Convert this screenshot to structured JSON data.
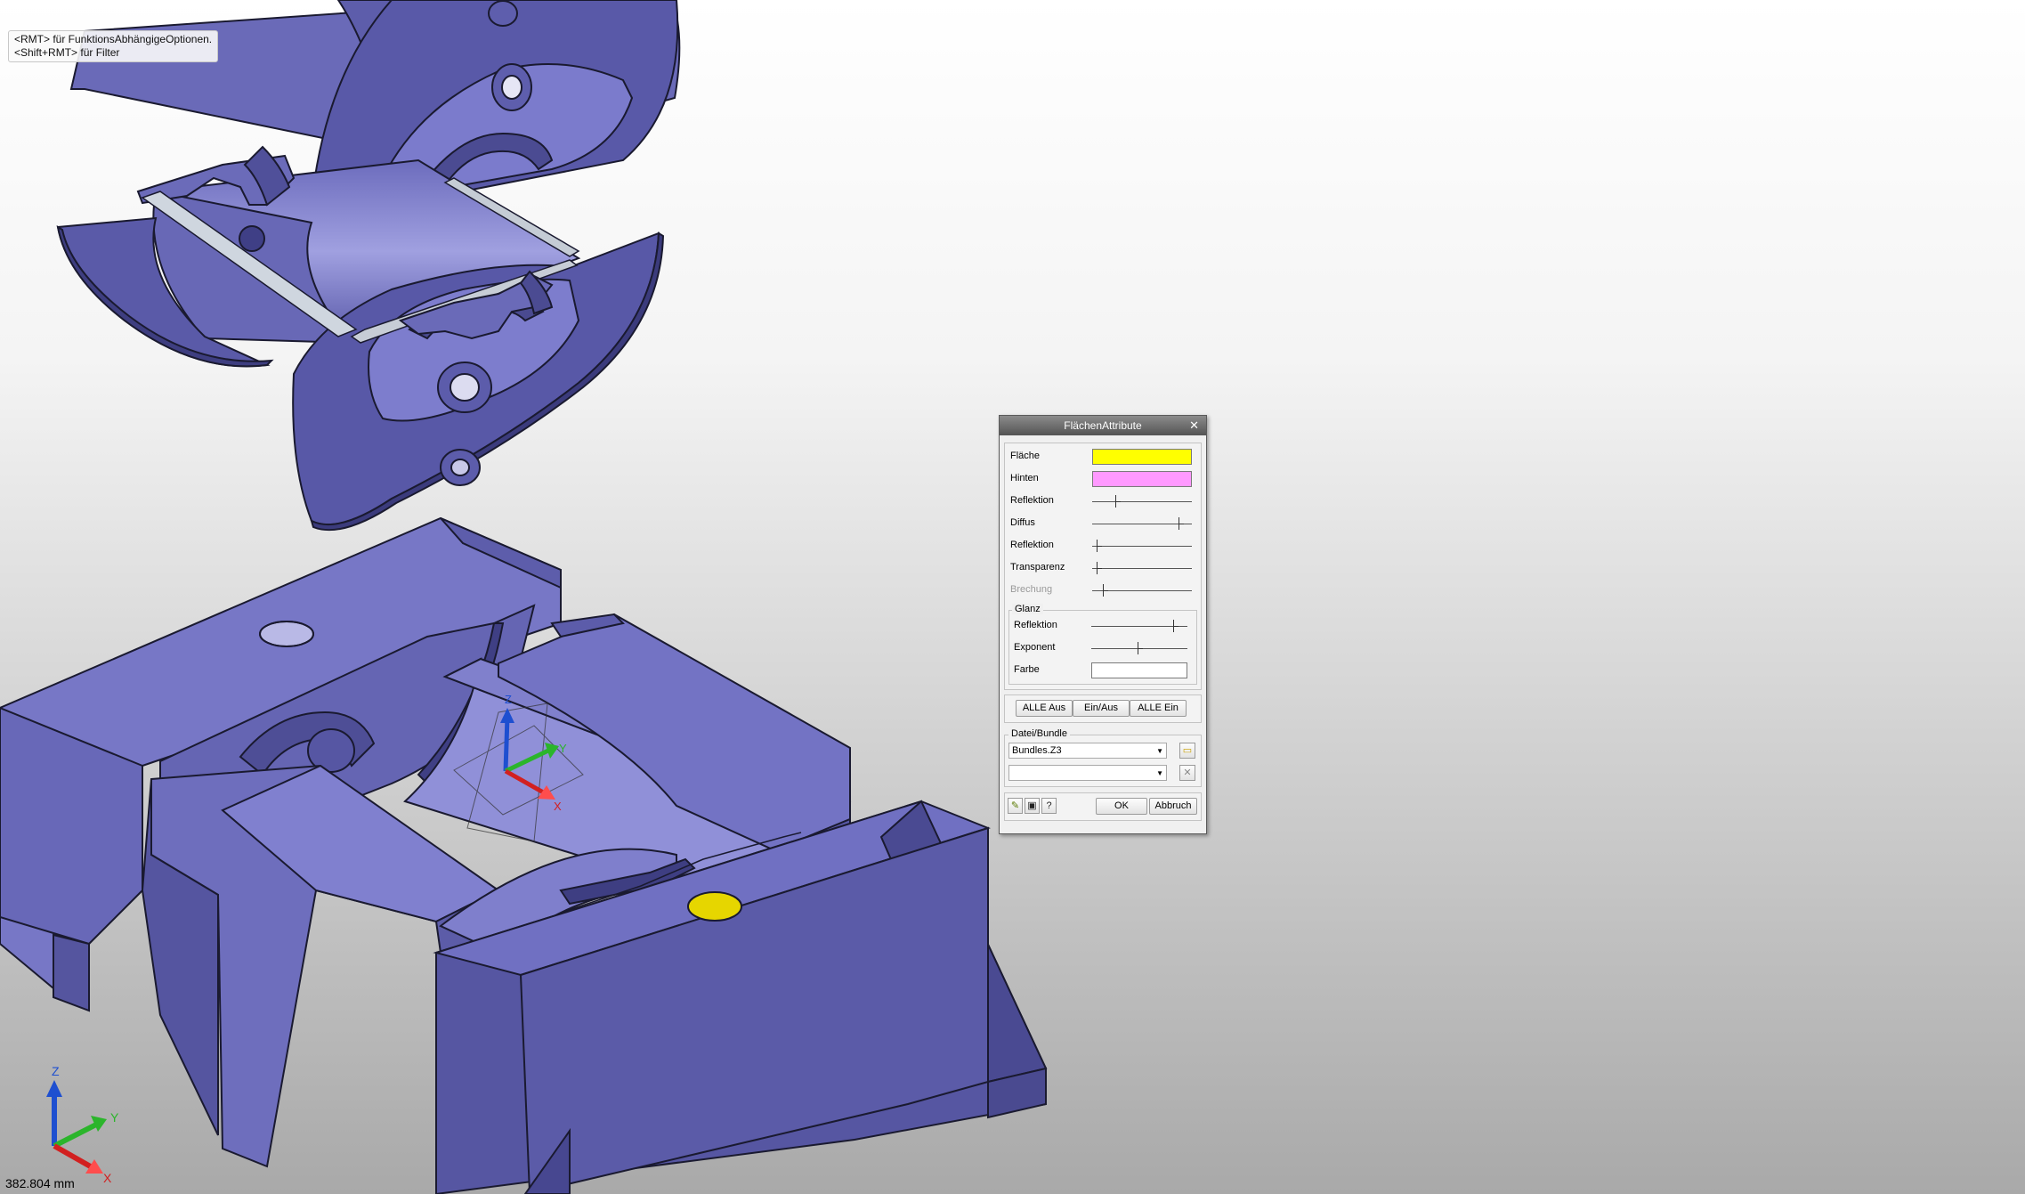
{
  "viewport": {
    "hint_line1": "<RMT> für FunktionsAbhängigeOptionen.",
    "hint_line2": "<Shift+RMT> für Filter",
    "scale_text": "382.804 mm",
    "axis_x": "X",
    "axis_y": "Y",
    "axis_z": "Z"
  },
  "colors": {
    "part_face": "#7373c4",
    "part_dark": "#4d4d8f",
    "part_mid": "#6464b0",
    "flaeche": "#ffff00",
    "hinten": "#ff99ff",
    "farbe": "#ffffff",
    "hole_highlight": "#e6d600"
  },
  "dialog": {
    "title": "FlächenAttribute",
    "close_icon": "close-icon",
    "labels": {
      "flaeche": "Fläche",
      "hinten": "Hinten",
      "reflektion1": "Reflektion",
      "diffus": "Diffus",
      "reflektion2": "Reflektion",
      "transparenz": "Transparenz",
      "brechung": "Brechung"
    },
    "glanz": {
      "legend": "Glanz",
      "reflektion": "Reflektion",
      "exponent": "Exponent",
      "farbe": "Farbe"
    },
    "sliders": {
      "reflektion1": 0.25,
      "diffus": 0.93,
      "reflektion2": 0.05,
      "transparenz": 0.05,
      "brechung": 0.12,
      "glanz_reflektion": 0.92,
      "glanz_exponent": 0.52
    },
    "buttons": {
      "alle_aus": "ALLE Aus",
      "ein_aus": "Ein/Aus",
      "alle_ein": "ALLE Ein"
    },
    "datei": {
      "legend": "Datei/Bundle",
      "bundle_value": "Bundles.Z3",
      "second_value": ""
    },
    "footer": {
      "ok": "OK",
      "abbruch": "Abbruch"
    }
  }
}
